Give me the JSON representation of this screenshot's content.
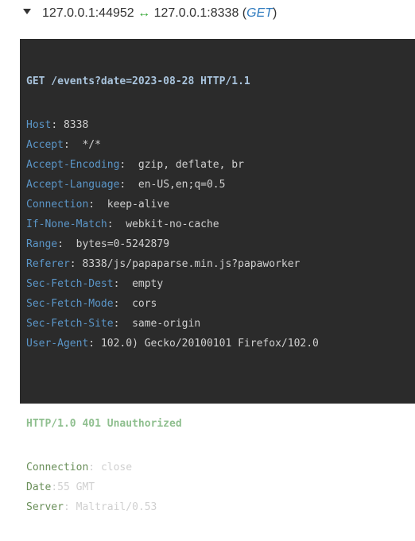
{
  "header": {
    "source": "127.0.0.1:44952",
    "destination": "127.0.0.1:8338",
    "method": "GET",
    "arrow": "↔"
  },
  "request": {
    "line": "GET /events?date=2023-08-28 HTTP/1.1",
    "headers": [
      {
        "key": "Host",
        "sep": ": ",
        "value": "8338"
      },
      {
        "key": "Accept",
        "sep": ":  ",
        "value": "*/*"
      },
      {
        "key": "Accept-Encoding",
        "sep": ":  ",
        "value": "gzip, deflate, br"
      },
      {
        "key": "Accept-Language",
        "sep": ":  ",
        "value": "en-US,en;q=0.5"
      },
      {
        "key": "Connection",
        "sep": ":  ",
        "value": "keep-alive"
      },
      {
        "key": "If-None-Match",
        "sep": ":  ",
        "value": "webkit-no-cache"
      },
      {
        "key": "Range",
        "sep": ":  ",
        "value": "bytes=0-5242879"
      },
      {
        "key": "Referer",
        "sep": ": ",
        "value": "8338/js/papaparse.min.js?papaworker"
      },
      {
        "key": "Sec-Fetch-Dest",
        "sep": ":  ",
        "value": "empty"
      },
      {
        "key": "Sec-Fetch-Mode",
        "sep": ":  ",
        "value": "cors"
      },
      {
        "key": "Sec-Fetch-Site",
        "sep": ":  ",
        "value": "same-origin"
      },
      {
        "key": "User-Agent",
        "sep": ": ",
        "value": "102.0) Gecko/20100101 Firefox/102.0"
      }
    ]
  },
  "response": {
    "line": "HTTP/1.0 401 Unauthorized",
    "headers": [
      {
        "key": "Connection",
        "sep": ": ",
        "value": "close"
      },
      {
        "key": "Date",
        "sep": ":",
        "value": "55 GMT"
      },
      {
        "key": "Server",
        "sep": ": ",
        "value": "Maltrail/0.53"
      }
    ]
  }
}
